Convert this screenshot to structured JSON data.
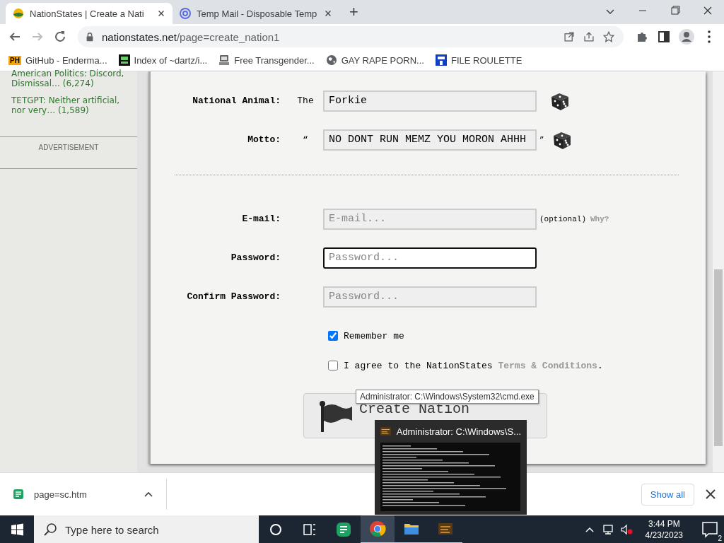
{
  "browser": {
    "tabs": [
      {
        "title": "NationStates | Create a Nati",
        "selected": true
      },
      {
        "title": "Temp Mail - Disposable Temp",
        "selected": false
      }
    ],
    "new_tab": "+",
    "address": {
      "domain": "nationstates.net",
      "path": "/page=create_nation1"
    },
    "bookmarks": [
      {
        "label": "GitHub - Enderma...",
        "badge": "PH"
      },
      {
        "label": "Index of ~dartz/i..."
      },
      {
        "label": "Free Transgender..."
      },
      {
        "label": "GAY RAPE PORN..."
      },
      {
        "label": "FILE ROULETTE"
      }
    ]
  },
  "sidebar": {
    "links": [
      "American Politics: Discord, Dismissal… (6,274)",
      "TETGPT: Neither artificial, nor very… (1,589)"
    ],
    "advertisement": "ADVERTISEMENT"
  },
  "form": {
    "details": [
      {
        "label": "National Animal:",
        "prefix": "The",
        "value": "Forkie"
      },
      {
        "label": "Motto:",
        "prefix": "“",
        "value": "NO DONT RUN MEMZ YOU MORON AHHH",
        "suffix": "”"
      }
    ],
    "account": [
      {
        "label": "E-mail:",
        "placeholder": "E-mail...",
        "focused": false,
        "note": "(optional)",
        "link": "Why?"
      },
      {
        "label": "Password:",
        "placeholder": "Password...",
        "focused": true
      },
      {
        "label": "Confirm Password:",
        "placeholder": "Password...",
        "focused": false
      }
    ],
    "checkboxes": [
      {
        "text": "Remember me",
        "checked": true
      },
      {
        "text": "I agree to the NationStates",
        "link": "Terms & Conditions",
        "after": ".",
        "checked": false
      }
    ],
    "submit": "Create Nation"
  },
  "tooltip": "Administrator: C:\\Windows\\System32\\cmd.exe",
  "preview": {
    "title": "Administrator: C:\\Windows\\S..."
  },
  "download": {
    "file": "page=sc.htm",
    "show_all": "Show all"
  },
  "taskbar": {
    "search_placeholder": "Type here to search",
    "apps": [
      {
        "running": false,
        "selected": false
      },
      {
        "running": true,
        "selected": true
      },
      {
        "running": true,
        "selected": false
      },
      {
        "running": true,
        "selected": false
      }
    ],
    "time": "3:44 PM",
    "date": "4/23/2023",
    "notifications": "2"
  }
}
